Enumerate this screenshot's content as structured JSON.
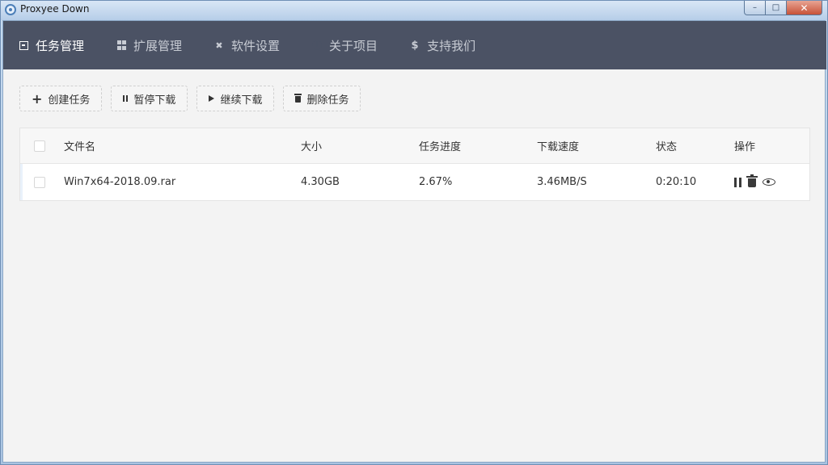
{
  "window": {
    "title": "Proxyee Down",
    "controls": {
      "minimize": "–",
      "maximize": "□",
      "close": "✕"
    }
  },
  "nav": {
    "items": [
      {
        "label": "任务管理",
        "icon": "task-icon",
        "active": true
      },
      {
        "label": "扩展管理",
        "icon": "extension-icon",
        "active": false
      },
      {
        "label": "软件设置",
        "icon": "tools-icon",
        "active": false
      },
      {
        "label": "关于项目",
        "icon": "info-icon",
        "active": false
      },
      {
        "label": "支持我们",
        "icon": "dollar-icon",
        "active": false
      }
    ]
  },
  "toolbar": {
    "create_label": "创建任务",
    "pause_label": "暂停下载",
    "resume_label": "继续下载",
    "delete_label": "删除任务"
  },
  "table": {
    "headers": {
      "name": "文件名",
      "size": "大小",
      "progress": "任务进度",
      "speed": "下载速度",
      "status": "状态",
      "ops": "操作"
    },
    "rows": [
      {
        "name": "Win7x64-2018.09.rar",
        "size": "4.30GB",
        "progress": "2.67%",
        "speed": "3.46MB/S",
        "status": "0:20:10"
      }
    ]
  },
  "colors": {
    "navbar": "#4b5264",
    "content_bg": "#f3f3f3",
    "accent_row": "#e9f1fb"
  }
}
